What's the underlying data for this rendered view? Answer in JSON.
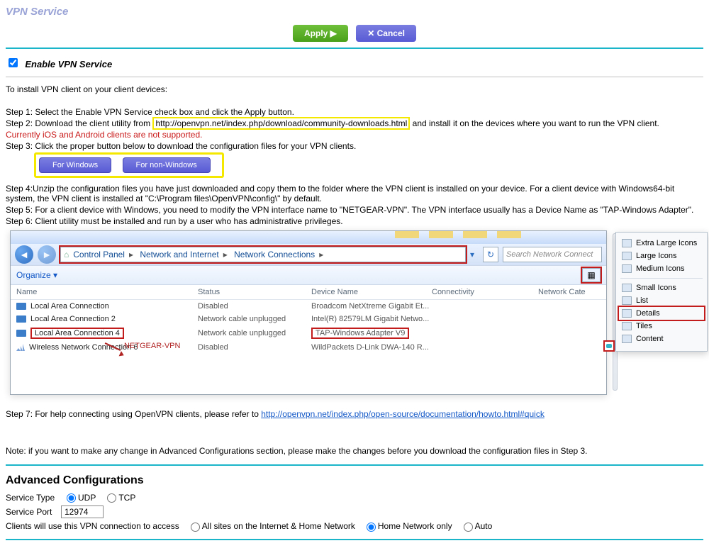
{
  "title": "VPN Service",
  "buttons": {
    "apply": "Apply ▶",
    "cancel": "✕ Cancel"
  },
  "enable_label": "Enable VPN Service",
  "intro": "To install VPN client on your client devices:",
  "step1": "Step 1: Select the Enable VPN Service check box and click the Apply button.",
  "step2a": "Step 2: Download the client utility from ",
  "step2_url": "http://openvpn.net/index.php/download/community-downloads.html",
  "step2b": " and install it on the devices where you want to run the VPN client.",
  "warn": "Currently iOS and Android clients are not supported.",
  "step3": "Step 3: Click the proper button below to download the configuration files for your VPN clients.",
  "btn_win": "For Windows",
  "btn_nonwin": "For non-Windows",
  "step4": "Step 4:Unzip the configuration files you have just downloaded and copy them to the folder where the VPN client is installed on your device. For a client device with Windows64-bit system, the VPN client is installed at \"C:\\Program files\\OpenVPN\\config\\\" by default.",
  "step5": "Step 5: For a client device with Windows, you need to modify the VPN interface name to \"NETGEAR-VPN\". The VPN interface usually has a Device Name as \"TAP-Windows Adapter\".",
  "step6": "Step 6: Client utility must be installed and run by a user who has administrative privileges.",
  "explorer": {
    "breadcrumbs": [
      "Control Panel",
      "Network and Internet",
      "Network Connections"
    ],
    "search_placeholder": "Search Network Connect",
    "organize": "Organize ▾",
    "columns": [
      "Name",
      "Status",
      "Device Name",
      "Connectivity",
      "Network Cate"
    ],
    "rows": [
      {
        "name": "Local Area Connection",
        "status": "Disabled",
        "device": "Broadcom NetXtreme Gigabit Et...",
        "icon": "nic"
      },
      {
        "name": "Local Area Connection 2",
        "status": "Network cable unplugged",
        "device": "Intel(R) 82579LM Gigabit Netwo...",
        "icon": "nic"
      },
      {
        "name": "Local Area Connection 4",
        "status": "Network cable unplugged",
        "device": "TAP-Windows Adapter V9",
        "icon": "nic"
      },
      {
        "name": "Wireless Network Connection 6",
        "status": "Disabled",
        "device": "WildPackets D-Link DWA-140 R...",
        "icon": "wifi"
      }
    ],
    "annotation": "NETGEAR-VPN"
  },
  "viewmenu": {
    "items": [
      "Extra Large Icons",
      "Large Icons",
      "Medium Icons",
      "Small Icons",
      "List",
      "Details",
      "Tiles",
      "Content"
    ]
  },
  "step7a": "Step 7: For help connecting using OpenVPN clients, please refer to ",
  "step7_url": "http://openvpn.net/index.php/open-source/documentation/howto.html#quick",
  "note": "Note: if you want to make any change in Advanced Configurations section, please make the changes before you download the configuration files in Step 3.",
  "adv_head": "Advanced Configurations",
  "svc_type_label": "Service Type",
  "svc_type_opts": {
    "udp": "UDP",
    "tcp": "TCP"
  },
  "svc_port_label": "Service Port",
  "svc_port_value": "12974",
  "access_label": "Clients will use this VPN connection to access",
  "access_opts": {
    "all": "All sites on the Internet & Home Network",
    "home": "Home Network only",
    "auto": "Auto"
  }
}
